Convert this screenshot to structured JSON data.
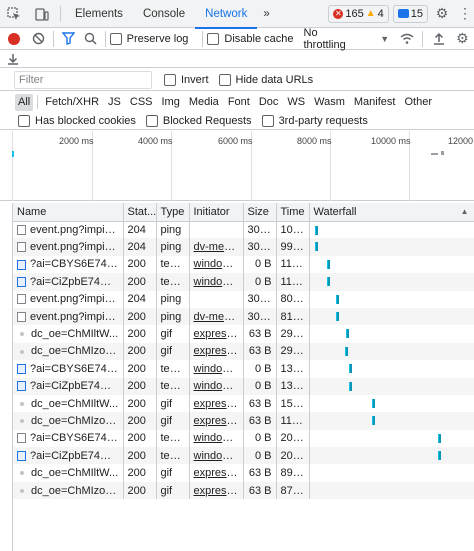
{
  "tabs": {
    "elements": "Elements",
    "console": "Console",
    "network": "Network",
    "more": "»"
  },
  "badges": {
    "errors": "165",
    "warnings": "4",
    "messages": "15"
  },
  "toolbar": {
    "preserve_log": "Preserve log",
    "disable_cache": "Disable cache",
    "throttling": "No throttling"
  },
  "filter": {
    "placeholder": "Filter",
    "invert": "Invert",
    "hide_data_urls": "Hide data URLs"
  },
  "types": [
    "All",
    "Fetch/XHR",
    "JS",
    "CSS",
    "Img",
    "Media",
    "Font",
    "Doc",
    "WS",
    "Wasm",
    "Manifest",
    "Other"
  ],
  "blocking": {
    "blocked_cookies": "Has blocked cookies",
    "blocked_requests": "Blocked Requests",
    "third_party": "3rd-party requests"
  },
  "overview_ticks": [
    "2000 ms",
    "4000 ms",
    "6000 ms",
    "8000 ms",
    "10000 ms",
    "12000"
  ],
  "columns": {
    "name": "Name",
    "status": "Stat...",
    "type": "Type",
    "initiator": "Initiator",
    "size": "Size",
    "time": "Time",
    "waterfall": "Waterfall"
  },
  "rows": [
    {
      "icon": "file",
      "name": "event.png?impid...",
      "status": "204",
      "type": "ping",
      "initiator": "",
      "size": "305 B",
      "time": "101...",
      "wf": 0.02
    },
    {
      "icon": "file",
      "name": "event.png?impid...",
      "status": "204",
      "type": "ping",
      "initiator": "dv-meas...",
      "size": "305 B",
      "time": "99 ...",
      "wf": 0.02
    },
    {
      "icon": "doc",
      "name": "?ai=CBYS6E74DY...",
      "status": "200",
      "type": "text...",
      "initiator": "window ...",
      "size": "0 B",
      "time": "115...",
      "wf": 0.1
    },
    {
      "icon": "doc",
      "name": "?ai=CiZpbE74DYr...",
      "status": "200",
      "type": "text...",
      "initiator": "window ...",
      "size": "0 B",
      "time": "115...",
      "wf": 0.1
    },
    {
      "icon": "file",
      "name": "event.png?impid...",
      "status": "204",
      "type": "ping",
      "initiator": "",
      "size": "305 B",
      "time": "80 ...",
      "wf": 0.16
    },
    {
      "icon": "file",
      "name": "event.png?impid...",
      "status": "200",
      "type": "ping",
      "initiator": "dv-meas...",
      "size": "305 B",
      "time": "81 ...",
      "wf": 0.16
    },
    {
      "icon": "img",
      "name": "dc_oe=ChMIltW...",
      "status": "200",
      "type": "gif",
      "initiator": "express ...",
      "size": "63 B",
      "time": "291...",
      "wf": 0.23
    },
    {
      "icon": "img",
      "name": "dc_oe=ChMIzoy...",
      "status": "200",
      "type": "gif",
      "initiator": "express ...",
      "size": "63 B",
      "time": "291...",
      "wf": 0.22
    },
    {
      "icon": "doc",
      "name": "?ai=CBYS6E74DY...",
      "status": "200",
      "type": "text...",
      "initiator": "window ...",
      "size": "0 B",
      "time": "131...",
      "wf": 0.25
    },
    {
      "icon": "doc",
      "name": "?ai=CiZpbE74DYr...",
      "status": "200",
      "type": "text...",
      "initiator": "window ...",
      "size": "0 B",
      "time": "135...",
      "wf": 0.25
    },
    {
      "icon": "img",
      "name": "dc_oe=ChMIltW...",
      "status": "200",
      "type": "gif",
      "initiator": "express ...",
      "size": "63 B",
      "time": "159...",
      "wf": 0.4
    },
    {
      "icon": "img",
      "name": "dc_oe=ChMIzoy...",
      "status": "200",
      "type": "gif",
      "initiator": "express ...",
      "size": "63 B",
      "time": "117...",
      "wf": 0.4
    },
    {
      "icon": "file",
      "name": "?ai=CBYS6E74DY...",
      "status": "200",
      "type": "text...",
      "initiator": "window ...",
      "size": "0 B",
      "time": "208...",
      "wf": 0.84
    },
    {
      "icon": "doc",
      "name": "?ai=CiZpbE74DYr...",
      "status": "200",
      "type": "text...",
      "initiator": "window ...",
      "size": "0 B",
      "time": "205...",
      "wf": 0.84
    },
    {
      "icon": "img",
      "name": "dc_oe=ChMIltW...",
      "status": "200",
      "type": "gif",
      "initiator": "express ...",
      "size": "63 B",
      "time": "89 ...",
      "wf": null
    },
    {
      "icon": "img",
      "name": "dc_oe=ChMIzoy...",
      "status": "200",
      "type": "gif",
      "initiator": "express ...",
      "size": "63 B",
      "time": "87 ...",
      "wf": null
    }
  ],
  "colors": {
    "accent": "#1a73e8",
    "record": "#d93025",
    "waterfall_light": "#13c2e8",
    "waterfall_dark": "#0a97b7"
  }
}
